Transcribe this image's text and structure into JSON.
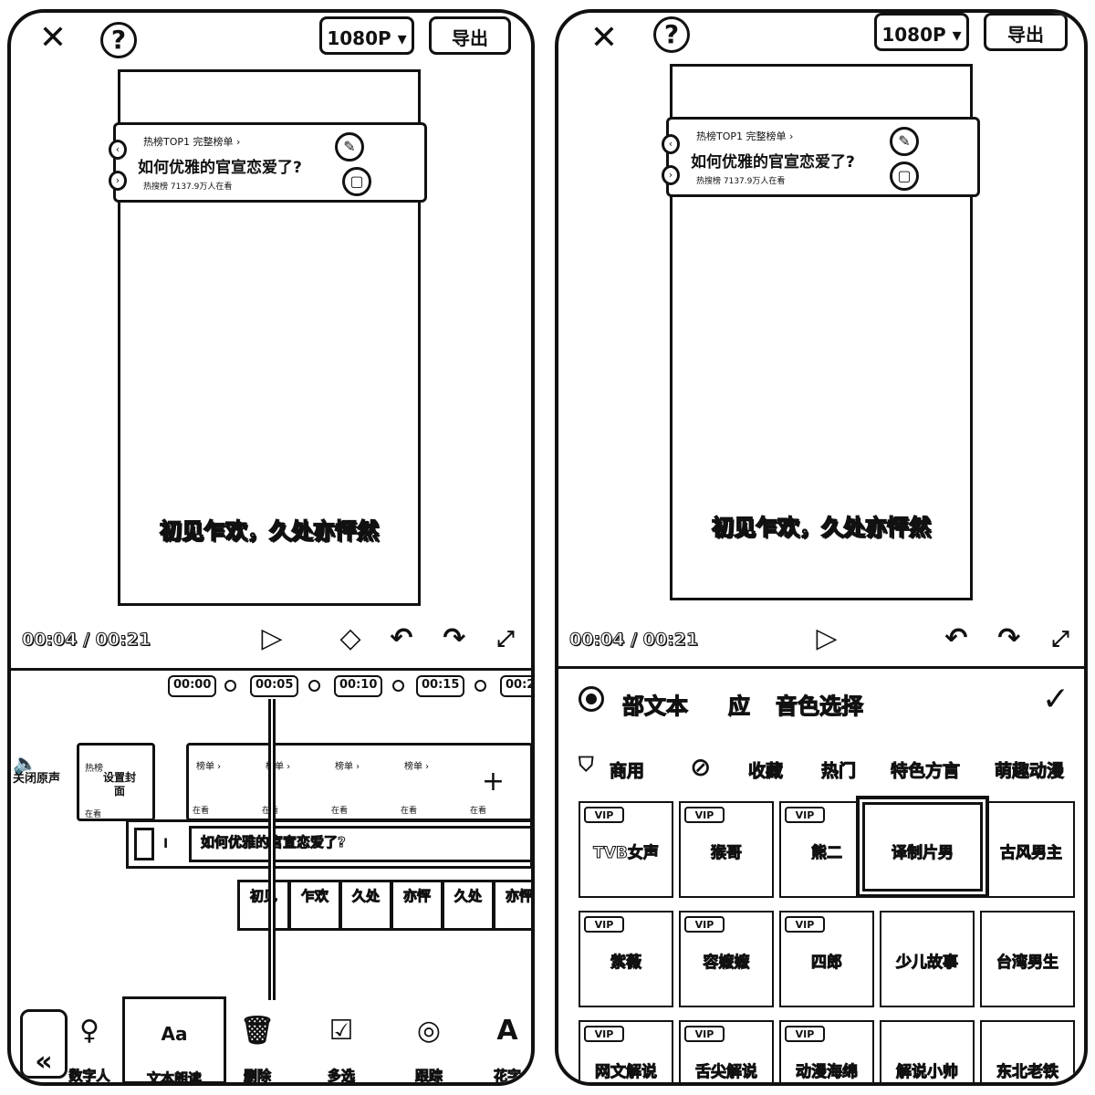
{
  "left": {
    "resolution": "1080P",
    "export_label": "导出",
    "hot_card": {
      "top_line": "热榜TOP1  完整榜单 ›",
      "title": "如何优雅的官宣恋爱了?",
      "sub_line": "热搜榜  7137.9万人在看"
    },
    "subtitle": "初见乍欢，久处亦怦然",
    "time": "00:04 / 00:21",
    "ticks": [
      "00:00",
      "00:05",
      "00:10",
      "00:15",
      "00:2"
    ],
    "audio_label": "关闭原声",
    "cover": {
      "top": "热榜",
      "label": "设置封面",
      "bottom": "在看"
    },
    "frames": [
      {
        "top": "榜单 ›",
        "bottom": "在看"
      },
      {
        "top": "榜单 ›",
        "bottom": "在看"
      },
      {
        "top": "榜单 ›",
        "bottom": "在看"
      },
      {
        "top": "榜单 ›",
        "bottom": "在看"
      },
      {
        "top": "",
        "bottom": "在看"
      }
    ],
    "text_clip": "如何优雅的官宣恋爱了?",
    "word_clips": [
      "初见",
      "乍欢",
      "久处",
      "亦怦",
      "久处",
      "亦怦"
    ],
    "tools": [
      {
        "icon": "♀",
        "label": "数字人"
      },
      {
        "icon": "Aa",
        "label": "文本朗读"
      },
      {
        "icon": "🗑",
        "label": "删除"
      },
      {
        "icon": "☑",
        "label": "多选"
      },
      {
        "icon": "◎",
        "label": "跟踪"
      },
      {
        "icon": "A",
        "label": "花字"
      }
    ]
  },
  "right": {
    "resolution": "1080P",
    "export_label": "导出",
    "hot_card": {
      "top_line": "热榜TOP1  完整榜单 ›",
      "title": "如何优雅的官宣恋爱了?",
      "sub_line": "热搜榜  7137.9万人在看"
    },
    "subtitle": "初见乍欢，久处亦怦然",
    "time": "00:04 / 00:21",
    "header": {
      "scope": "部文本",
      "apply": "应",
      "title": "音色选择"
    },
    "categories": [
      "商用",
      "收藏",
      "热门",
      "特色方言",
      "萌趣动漫"
    ],
    "vip_label": "VIP",
    "voices": [
      {
        "name": "TVB女声",
        "vip": true
      },
      {
        "name": "猴哥",
        "vip": true
      },
      {
        "name": "熊二",
        "vip": true
      },
      {
        "name": "译制片男",
        "vip": false,
        "selected": true
      },
      {
        "name": "古风男主",
        "vip": false
      },
      {
        "name": "紫薇",
        "vip": true
      },
      {
        "name": "容嬷嬷",
        "vip": true
      },
      {
        "name": "四郎",
        "vip": true
      },
      {
        "name": "少儿故事",
        "vip": false
      },
      {
        "name": "台湾男生",
        "vip": false
      },
      {
        "name": "网文解说",
        "vip": true
      },
      {
        "name": "舌尖解说",
        "vip": true
      },
      {
        "name": "动漫海绵",
        "vip": true
      },
      {
        "name": "解说小帅",
        "vip": false
      },
      {
        "name": "东北老铁",
        "vip": false
      }
    ]
  }
}
